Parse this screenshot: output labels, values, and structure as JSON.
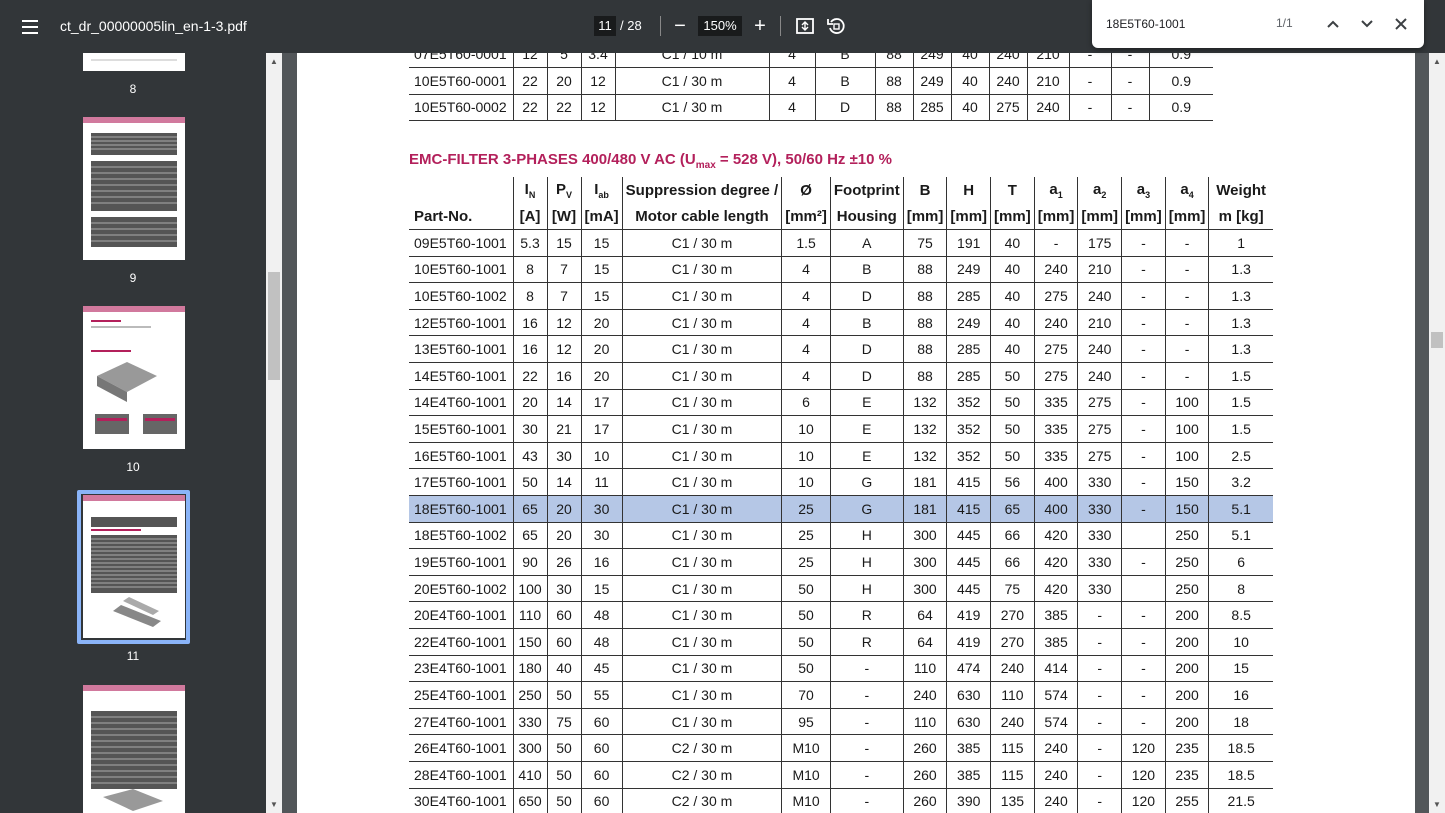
{
  "toolbar": {
    "file_name": "ct_dr_00000005lin_en-1-3.pdf",
    "current_page": "11",
    "total_pages": "/ 28",
    "zoom": "150%"
  },
  "find": {
    "query": "18E5T60-1001",
    "count": "1/1"
  },
  "thumbnails": [
    "8",
    "9",
    "10",
    "11"
  ],
  "top_table": {
    "rows": [
      [
        "07E5T60-0001",
        "12",
        "5",
        "3.4",
        "C1 / 10 m",
        "4",
        "B",
        "88",
        "249",
        "40",
        "240",
        "210",
        "-",
        "-",
        "0.9"
      ],
      [
        "10E5T60-0001",
        "22",
        "20",
        "12",
        "C1 / 30 m",
        "4",
        "B",
        "88",
        "249",
        "40",
        "240",
        "210",
        "-",
        "-",
        "0.9"
      ],
      [
        "10E5T60-0002",
        "22",
        "22",
        "12",
        "C1 / 30 m",
        "4",
        "D",
        "88",
        "285",
        "40",
        "275",
        "240",
        "-",
        "-",
        "0.9"
      ]
    ]
  },
  "emc": {
    "title": "EMC-FILTER 3-PHASES 400/480 V AC (U",
    "title_sub": "max",
    "title_rest": " = 528 V), 50/60 Hz ±10 %",
    "header_top": [
      "",
      "I",
      "P",
      "I",
      "Suppression degree /",
      "Ø",
      "Footprint",
      "B",
      "H",
      "T",
      "a",
      "a",
      "a",
      "a",
      "Weight"
    ],
    "header_sub": [
      "",
      "N",
      "V",
      "ab",
      "",
      "",
      "",
      "",
      "",
      "",
      "1",
      "2",
      "3",
      "4",
      ""
    ],
    "header_bottom": [
      "Part-No.",
      "[A]",
      "[W]",
      "[mA]",
      "Motor cable length",
      "[mm²]",
      "Housing",
      "[mm]",
      "[mm]",
      "[mm]",
      "[mm]",
      "[mm]",
      "[mm]",
      "[mm]",
      "m [kg]"
    ],
    "rows": [
      [
        "09E5T60-1001",
        "5.3",
        "15",
        "15",
        "C1 / 30 m",
        "1.5",
        "A",
        "75",
        "191",
        "40",
        "-",
        "175",
        "-",
        "-",
        "1"
      ],
      [
        "10E5T60-1001",
        "8",
        "7",
        "15",
        "C1 / 30 m",
        "4",
        "B",
        "88",
        "249",
        "40",
        "240",
        "210",
        "-",
        "-",
        "1.3"
      ],
      [
        "10E5T60-1002",
        "8",
        "7",
        "15",
        "C1 / 30 m",
        "4",
        "D",
        "88",
        "285",
        "40",
        "275",
        "240",
        "-",
        "-",
        "1.3"
      ],
      [
        "12E5T60-1001",
        "16",
        "12",
        "20",
        "C1 / 30 m",
        "4",
        "B",
        "88",
        "249",
        "40",
        "240",
        "210",
        "-",
        "-",
        "1.3"
      ],
      [
        "13E5T60-1001",
        "16",
        "12",
        "20",
        "C1 / 30 m",
        "4",
        "D",
        "88",
        "285",
        "40",
        "275",
        "240",
        "-",
        "-",
        "1.3"
      ],
      [
        "14E5T60-1001",
        "22",
        "16",
        "20",
        "C1 / 30 m",
        "4",
        "D",
        "88",
        "285",
        "50",
        "275",
        "240",
        "-",
        "-",
        "1.5"
      ],
      [
        "14E4T60-1001",
        "20",
        "14",
        "17",
        "C1 / 30 m",
        "6",
        "E",
        "132",
        "352",
        "50",
        "335",
        "275",
        "-",
        "100",
        "1.5"
      ],
      [
        "15E5T60-1001",
        "30",
        "21",
        "17",
        "C1 / 30 m",
        "10",
        "E",
        "132",
        "352",
        "50",
        "335",
        "275",
        "-",
        "100",
        "1.5"
      ],
      [
        "16E5T60-1001",
        "43",
        "30",
        "10",
        "C1 / 30 m",
        "10",
        "E",
        "132",
        "352",
        "50",
        "335",
        "275",
        "-",
        "100",
        "2.5"
      ],
      [
        "17E5T60-1001",
        "50",
        "14",
        "11",
        "C1 / 30 m",
        "10",
        "G",
        "181",
        "415",
        "56",
        "400",
        "330",
        "-",
        "150",
        "3.2"
      ],
      [
        "18E5T60-1001",
        "65",
        "20",
        "30",
        "C1 / 30 m",
        "25",
        "G",
        "181",
        "415",
        "65",
        "400",
        "330",
        "-",
        "150",
        "5.1"
      ],
      [
        "18E5T60-1002",
        "65",
        "20",
        "30",
        "C1 / 30 m",
        "25",
        "H",
        "300",
        "445",
        "66",
        "420",
        "330",
        "",
        "250",
        "5.1"
      ],
      [
        "19E5T60-1001",
        "90",
        "26",
        "16",
        "C1 / 30 m",
        "25",
        "H",
        "300",
        "445",
        "66",
        "420",
        "330",
        "-",
        "250",
        "6"
      ],
      [
        "20E5T60-1002",
        "100",
        "30",
        "15",
        "C1 / 30 m",
        "50",
        "H",
        "300",
        "445",
        "75",
        "420",
        "330",
        "",
        "250",
        "8"
      ],
      [
        "20E4T60-1001",
        "110",
        "60",
        "48",
        "C1 / 30 m",
        "50",
        "R",
        "64",
        "419",
        "270",
        "385",
        "-",
        "-",
        "200",
        "8.5"
      ],
      [
        "22E4T60-1001",
        "150",
        "60",
        "48",
        "C1 / 30 m",
        "50",
        "R",
        "64",
        "419",
        "270",
        "385",
        "-",
        "-",
        "200",
        "10"
      ],
      [
        "23E4T60-1001",
        "180",
        "40",
        "45",
        "C1 / 30 m",
        "50",
        "-",
        "110",
        "474",
        "240",
        "414",
        "-",
        "-",
        "200",
        "15"
      ],
      [
        "25E4T60-1001",
        "250",
        "50",
        "55",
        "C1 / 30 m",
        "70",
        "-",
        "240",
        "630",
        "110",
        "574",
        "-",
        "-",
        "200",
        "16"
      ],
      [
        "27E4T60-1001",
        "330",
        "75",
        "60",
        "C1 / 30 m",
        "95",
        "-",
        "110",
        "630",
        "240",
        "574",
        "-",
        "-",
        "200",
        "18"
      ],
      [
        "26E4T60-1001",
        "300",
        "50",
        "60",
        "C2 / 30 m",
        "M10",
        "-",
        "260",
        "385",
        "115",
        "240",
        "-",
        "120",
        "235",
        "18.5"
      ],
      [
        "28E4T60-1001",
        "410",
        "50",
        "60",
        "C2 / 30 m",
        "M10",
        "-",
        "260",
        "385",
        "115",
        "240",
        "-",
        "120",
        "235",
        "18.5"
      ],
      [
        "30E4T60-1001",
        "650",
        "50",
        "60",
        "C2 / 30 m",
        "M10",
        "-",
        "260",
        "390",
        "135",
        "240",
        "-",
        "120",
        "255",
        "21.5"
      ]
    ],
    "highlight_row": 10
  }
}
